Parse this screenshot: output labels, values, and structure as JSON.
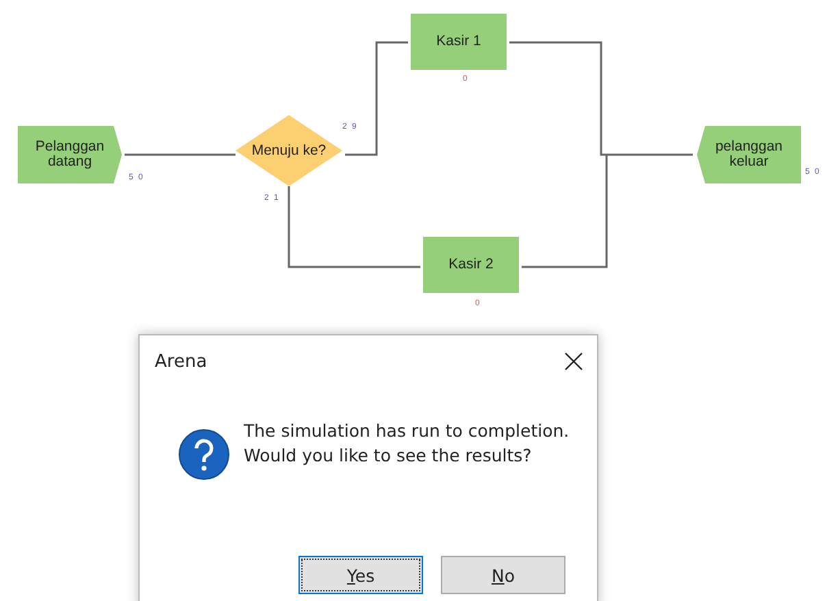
{
  "flowchart": {
    "nodes": [
      {
        "kind": "create",
        "label": "Pelanggan datang",
        "counter": "5 0",
        "color": "#5b55c8"
      },
      {
        "kind": "decide",
        "label": "Menuju ke?",
        "counter": "2 9",
        "color": "#5b55c8",
        "counter_2": "2 1"
      },
      {
        "kind": "process",
        "label": "Kasir 1",
        "counter": "0",
        "color": "#d9534f"
      },
      {
        "kind": "process",
        "label": "Kasir 2",
        "counter": "0",
        "color": "#d9534f"
      },
      {
        "kind": "dispose",
        "label": "pelanggan keluar",
        "counter": "5 0",
        "color": "#5b55c8"
      }
    ]
  },
  "dialog": {
    "title": "Arena",
    "message_lines": [
      "The simulation has run to completion.",
      "Would you like to see the results?"
    ],
    "buttons": [
      {
        "mnemonic": "Y",
        "rest": "es",
        "focused": true
      },
      {
        "mnemonic": "N",
        "rest": "o",
        "focused": false
      }
    ]
  }
}
